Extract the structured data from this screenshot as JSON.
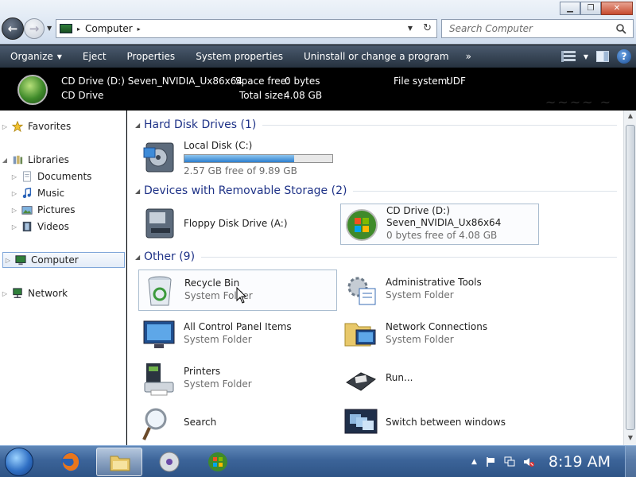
{
  "title_bar": {
    "window_controls": [
      "minimize",
      "maximize",
      "close"
    ]
  },
  "address": {
    "path": "Computer",
    "search_placeholder": "Search Computer"
  },
  "toolbar": {
    "items": [
      {
        "label": "Organize",
        "has_dropdown": true
      },
      {
        "label": "Eject"
      },
      {
        "label": "Properties"
      },
      {
        "label": "System properties"
      },
      {
        "label": "Uninstall or change a program"
      }
    ],
    "more": "»"
  },
  "details": {
    "name": "CD Drive (D:) Seven_NVIDIA_Ux86x64",
    "type": "CD Drive",
    "space_free_label": "Space free:",
    "space_free_value": "0 bytes",
    "total_size_label": "Total size:",
    "total_size_value": "4.08 GB",
    "fs_label": "File system:",
    "fs_value": "UDF"
  },
  "nav": {
    "items": [
      {
        "label": "Favorites",
        "icon": "star-icon",
        "level": 0
      },
      {
        "label": "Libraries",
        "icon": "libraries-icon",
        "level": 0
      },
      {
        "label": "Documents",
        "icon": "documents-icon",
        "level": 1
      },
      {
        "label": "Music",
        "icon": "music-icon",
        "level": 1
      },
      {
        "label": "Pictures",
        "icon": "pictures-icon",
        "level": 1
      },
      {
        "label": "Videos",
        "icon": "videos-icon",
        "level": 1
      },
      {
        "label": "Computer",
        "icon": "computer-icon",
        "level": 0,
        "selected": true
      },
      {
        "label": "Network",
        "icon": "network-icon",
        "level": 0
      }
    ]
  },
  "groups": {
    "hdd": {
      "title": "Hard Disk Drives (1)"
    },
    "removable": {
      "title": "Devices with Removable Storage (2)"
    },
    "other": {
      "title": "Other (9)"
    }
  },
  "items": {
    "local_disk": {
      "name": "Local Disk (C:)",
      "sub": "2.57 GB free of 9.89 GB",
      "used_fraction": 0.74
    },
    "floppy": {
      "name": "Floppy Disk Drive (A:)"
    },
    "cd": {
      "name": "CD Drive (D:)",
      "line2": "Seven_NVIDIA_Ux86x64",
      "sub": "0 bytes free of 4.08 GB"
    },
    "recycle": {
      "name": "Recycle Bin",
      "sub": "System Folder"
    },
    "admin": {
      "name": "Administrative Tools",
      "sub": "System Folder"
    },
    "control": {
      "name": "All Control Panel Items",
      "sub": "System Folder"
    },
    "netconn": {
      "name": "Network Connections",
      "sub": "System Folder"
    },
    "printers": {
      "name": "Printers",
      "sub": "System Folder"
    },
    "run": {
      "name": "Run..."
    },
    "search": {
      "name": "Search"
    },
    "switch": {
      "name": "Switch between windows"
    }
  },
  "taskbar": {
    "pinned": [
      "firefox-icon",
      "explorer-icon",
      "dvd-player-icon",
      "windows-logo-icon"
    ],
    "active": "explorer-icon",
    "clock": "8:19 AM"
  },
  "colors": {
    "group_title": "#1e3287",
    "toolbar_bg": "#26323f",
    "details_bg": "#000000",
    "taskbar_bg": "#3c6499"
  }
}
